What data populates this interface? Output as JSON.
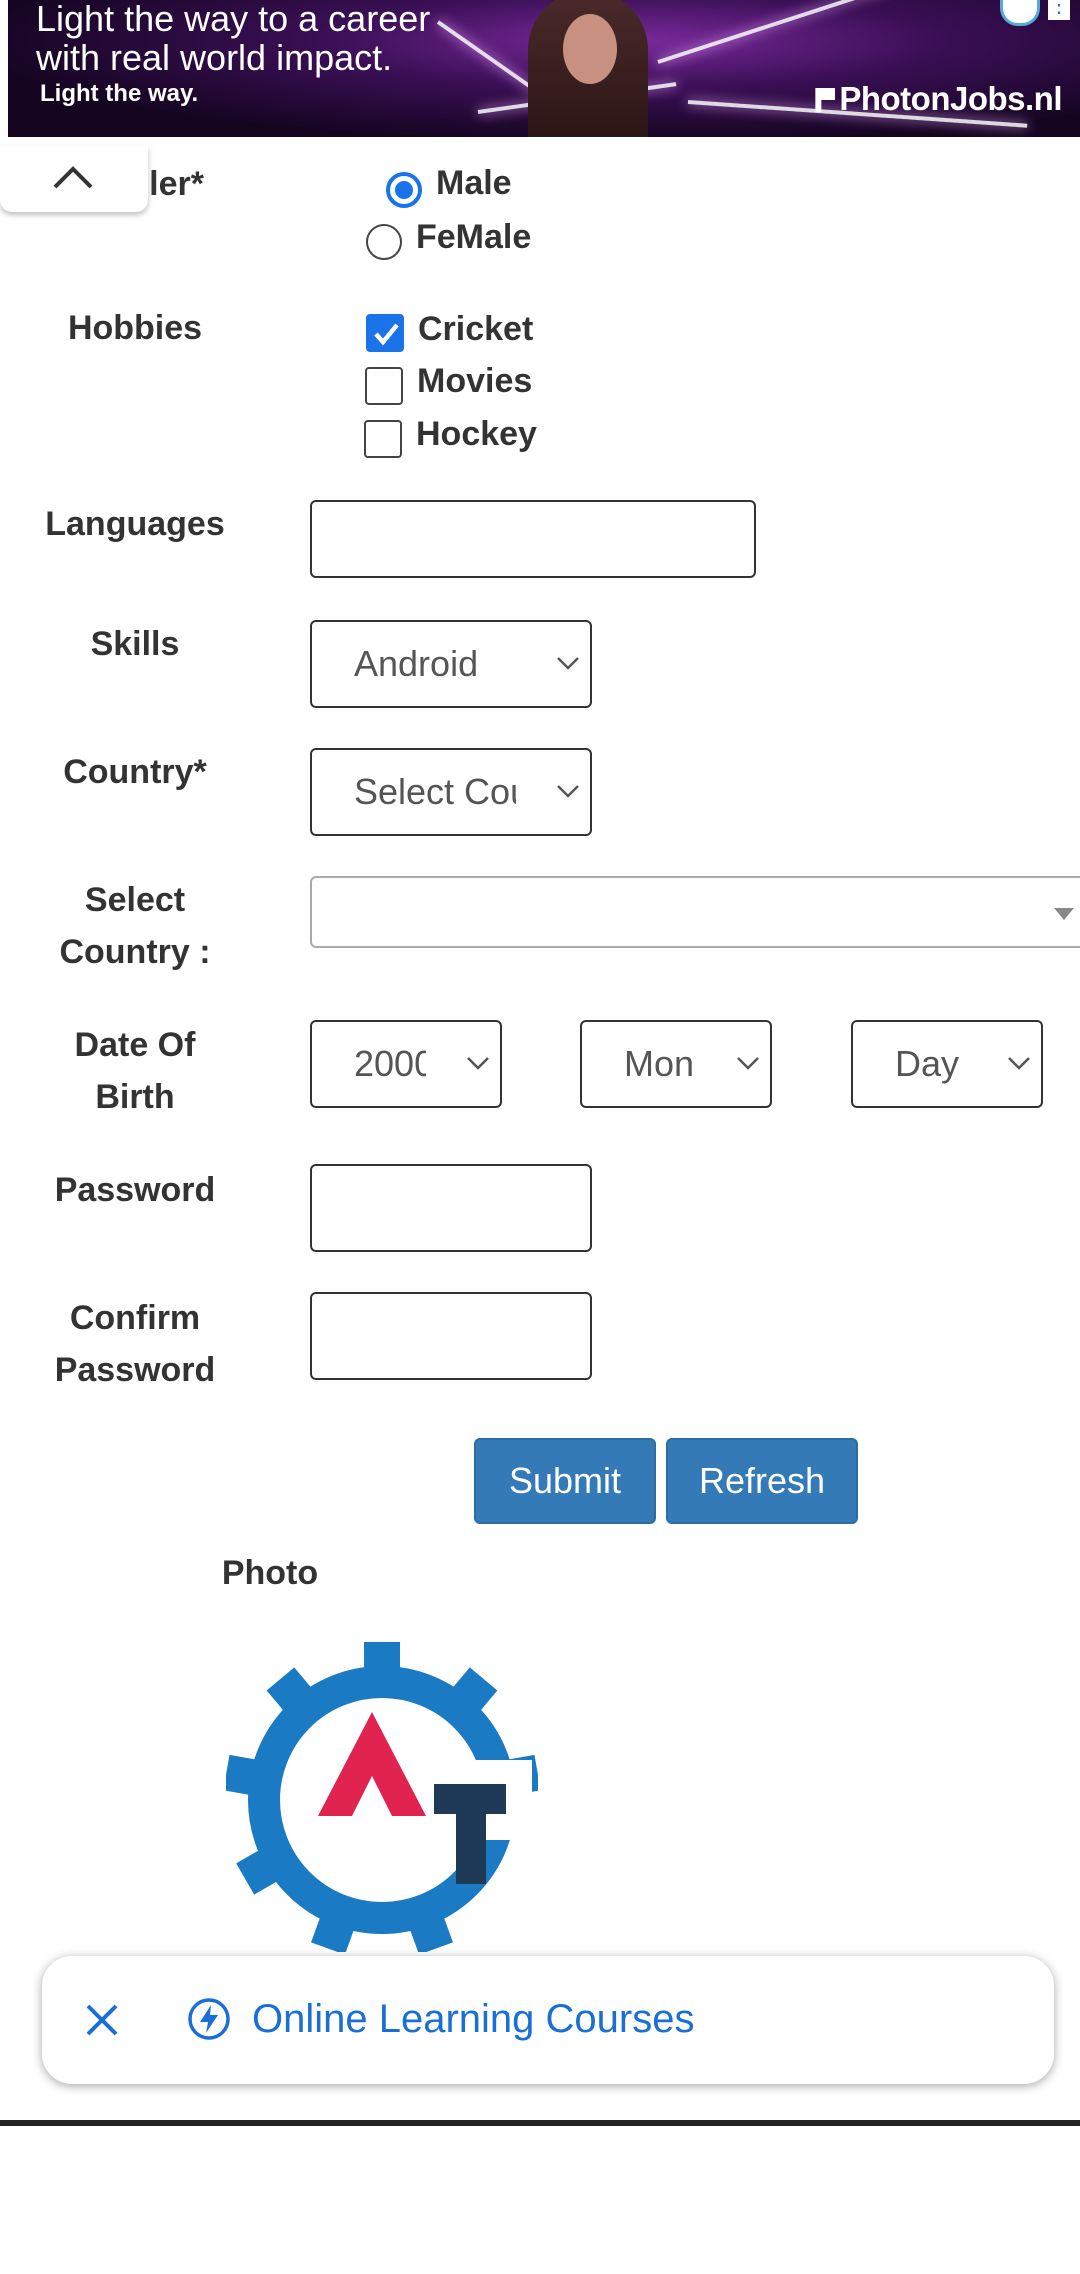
{
  "ad": {
    "line1": "Light the way to a career",
    "line2": "with real world impact.",
    "tagline": "Light the way.",
    "brand": "PhotonJobs.nl"
  },
  "form": {
    "gender": {
      "label": "ler*",
      "options": [
        {
          "label": "Male",
          "checked": true
        },
        {
          "label": "FeMale",
          "checked": false
        }
      ]
    },
    "hobbies": {
      "label": "Hobbies",
      "options": [
        {
          "label": "Cricket",
          "checked": true
        },
        {
          "label": "Movies",
          "checked": false
        },
        {
          "label": "Hockey",
          "checked": false
        }
      ]
    },
    "languages": {
      "label": "Languages",
      "value": ""
    },
    "skills": {
      "label": "Skills",
      "selected": "Android"
    },
    "country": {
      "label": "Country*",
      "selected": "Select Cou"
    },
    "select_country": {
      "label_line1": "Select",
      "label_line2": "Country :",
      "selected": ""
    },
    "dob": {
      "label_line1": "Date Of",
      "label_line2": "Birth",
      "year": "2000",
      "month": "Mon",
      "day": "Day"
    },
    "password": {
      "label": "Password",
      "value": ""
    },
    "confirm_password": {
      "label_line1": "Confirm",
      "label_line2": "Password",
      "value": ""
    },
    "submit_label": "Submit",
    "refresh_label": "Refresh",
    "photo_label": "Photo"
  },
  "toast": {
    "link_text": "Online Learning Courses"
  },
  "colors": {
    "accent_blue": "#1a73e8",
    "button_blue": "#337ab7",
    "logo_blue": "#1b7ac4",
    "logo_red": "#e0244f",
    "logo_navy": "#1f3a57"
  }
}
